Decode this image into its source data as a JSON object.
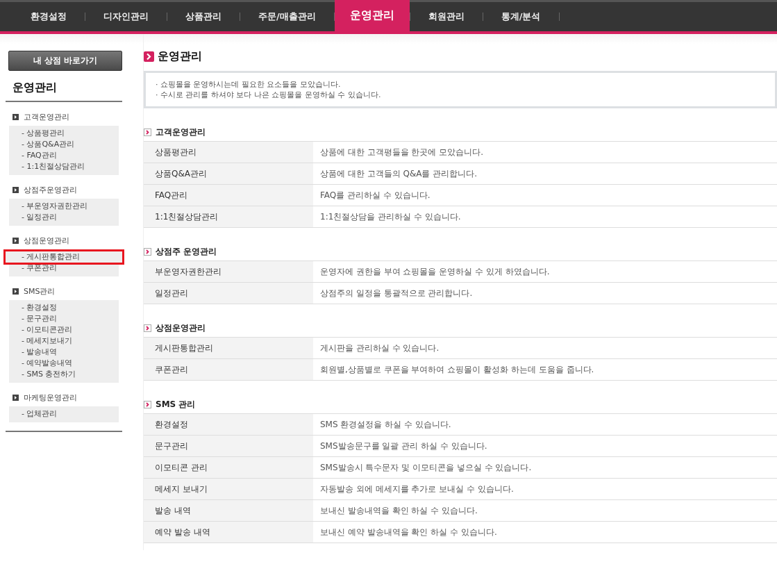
{
  "top_nav": [
    {
      "label": "환경설정",
      "selected": false
    },
    {
      "label": "디자인관리",
      "selected": false
    },
    {
      "label": "상품관리",
      "selected": false
    },
    {
      "label": "주문/매출관리",
      "selected": false
    },
    {
      "label": "운영관리",
      "selected": true
    },
    {
      "label": "회원관리",
      "selected": false
    },
    {
      "label": "통계/분석",
      "selected": false
    }
  ],
  "sidebar": {
    "shop_button": "내 상점 바로가기",
    "title": "운영관리",
    "groups": [
      {
        "label": "고객운영관리",
        "items": [
          {
            "label": "- 상품평관리",
            "highlighted": false
          },
          {
            "label": "- 상품Q&A관리",
            "highlighted": false
          },
          {
            "label": "- FAQ관리",
            "highlighted": false
          },
          {
            "label": "- 1:1친절상담관리",
            "highlighted": false
          }
        ]
      },
      {
        "label": "상점주운영관리",
        "items": [
          {
            "label": "- 부운영자권한관리",
            "highlighted": false
          },
          {
            "label": "- 일정관리",
            "highlighted": false
          }
        ]
      },
      {
        "label": "상점운영관리",
        "items": [
          {
            "label": "- 게시판통합관리",
            "highlighted": true
          },
          {
            "label": "- 쿠폰관리",
            "highlighted": false
          }
        ]
      },
      {
        "label": "SMS관리",
        "items": [
          {
            "label": "- 환경설정",
            "highlighted": false
          },
          {
            "label": "- 문구관리",
            "highlighted": false
          },
          {
            "label": "- 이모티콘관리",
            "highlighted": false
          },
          {
            "label": "- 메세지보내기",
            "highlighted": false
          },
          {
            "label": "- 발송내역",
            "highlighted": false
          },
          {
            "label": "- 예약발송내역",
            "highlighted": false
          },
          {
            "label": "- SMS 충전하기",
            "highlighted": false
          }
        ]
      },
      {
        "label": "마케팅운영관리",
        "items": [
          {
            "label": "- 업체관리",
            "highlighted": false
          }
        ]
      }
    ]
  },
  "main": {
    "title": "운영관리",
    "notes": [
      "· 쇼핑몰을 운영하시는데 필요한 요소들을 모았습니다.",
      "· 수시로 관리를 하셔야 보다 나은 쇼핑몰을 운영하실 수 있습니다."
    ],
    "sections": [
      {
        "title": "고객운영관리",
        "rows": [
          [
            "상품평관리",
            "상품에 대한 고객평들을 한곳에 모았습니다."
          ],
          [
            "상품Q&A관리",
            "상품에 대한 고객들의 Q&A를 관리합니다."
          ],
          [
            "FAQ관리",
            "FAQ를 관리하실 수 있습니다."
          ],
          [
            "1:1친절상담관리",
            "1:1친절상담을 관리하실 수 있습니다."
          ]
        ]
      },
      {
        "title": "상점주 운영관리",
        "rows": [
          [
            "부운영자권한관리",
            "운영자에 권한을 부여 쇼핑몰을 운영하실 수 있게 하였습니다."
          ],
          [
            "일정관리",
            "상점주의 일정을 통괄적으로 관리합니다."
          ]
        ]
      },
      {
        "title": "상점운영관리",
        "rows": [
          [
            "게시판통합관리",
            "게시판을 관리하실 수 있습니다."
          ],
          [
            "쿠폰관리",
            "회원별,상품별로 쿠폰을 부여하여 쇼핑몰이 활성화 하는데 도움을 줍니다."
          ]
        ]
      },
      {
        "title": "SMS 관리",
        "rows": [
          [
            "환경설정",
            "SMS 환경설정을 하실 수 있습니다."
          ],
          [
            "문구관리",
            "SMS발송문구를 일괄 관리 하실 수 있습니다."
          ],
          [
            "이모티콘 관리",
            "SMS발송시 특수문자 및 이모티콘을 넣으실 수 있습니다."
          ],
          [
            "메세지 보내기",
            "자동발송 외에 메세지를 추가로 보내실 수 있습니다."
          ],
          [
            "발송 내역",
            "보내신 발송내역을 확인 하실 수 있습니다."
          ],
          [
            "예약 발송 내역",
            "보내신 예약 발송내역을 확인 하실 수 있습니다."
          ]
        ]
      }
    ]
  }
}
